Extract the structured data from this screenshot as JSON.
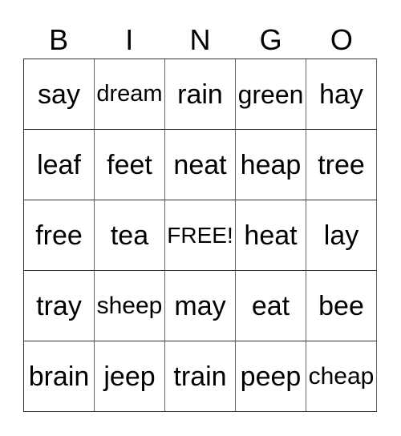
{
  "title_letters": [
    "B",
    "I",
    "N",
    "G",
    "O"
  ],
  "board": [
    [
      "say",
      "dream",
      "rain",
      "green",
      "hay"
    ],
    [
      "leaf",
      "feet",
      "neat",
      "heap",
      "tree"
    ],
    [
      "free",
      "tea",
      "FREE!",
      "heat",
      "lay"
    ],
    [
      "tray",
      "sheep",
      "may",
      "eat",
      "bee"
    ],
    [
      "brain",
      "jeep",
      "train",
      "peep",
      "cheap"
    ]
  ]
}
